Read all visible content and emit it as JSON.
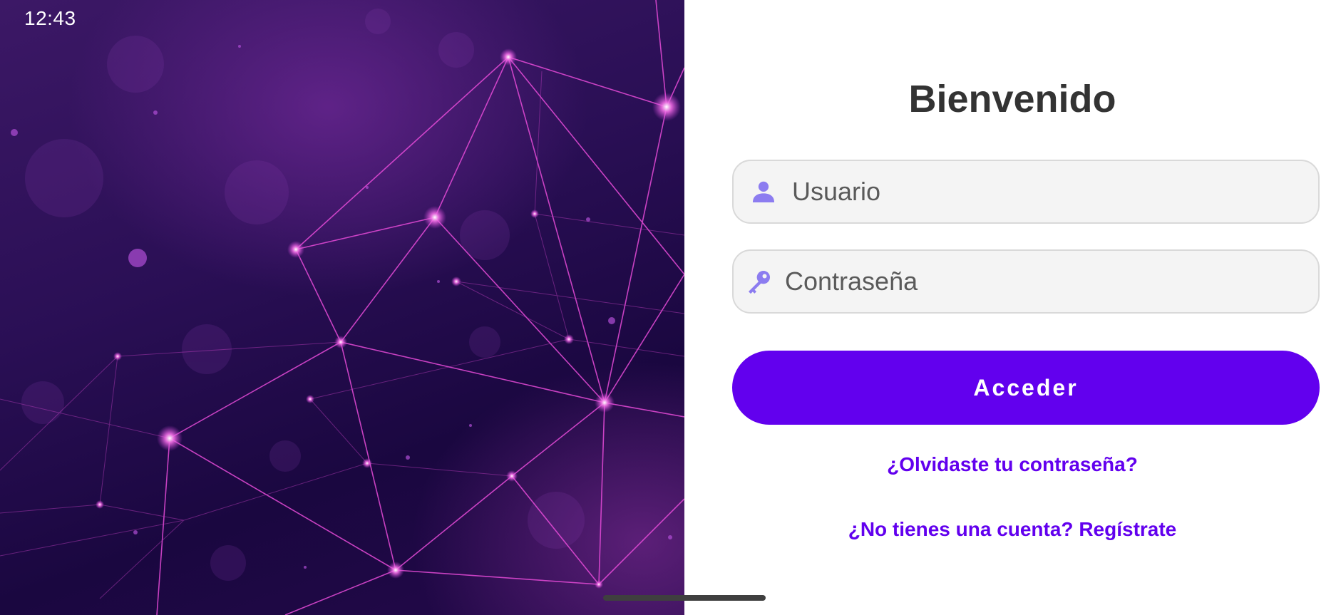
{
  "status_bar": {
    "time": "12:43"
  },
  "login": {
    "title": "Bienvenido",
    "username": {
      "placeholder": "Usuario",
      "value": "",
      "icon": "person-icon"
    },
    "password": {
      "placeholder": "Contraseña",
      "value": "",
      "icon": "key-icon"
    },
    "submit_label": "Acceder",
    "forgot_password_link": "¿Olvidaste tu contraseña?",
    "register_link": "¿No tienes una cuenta? Regístrate"
  },
  "colors": {
    "accent": "#6200EE",
    "icon_tint": "#8C7CF0",
    "title": "#333333",
    "field_background": "#F4F4F4",
    "hero_background": "#2A0F55",
    "hero_lines": "#E64BD8"
  }
}
